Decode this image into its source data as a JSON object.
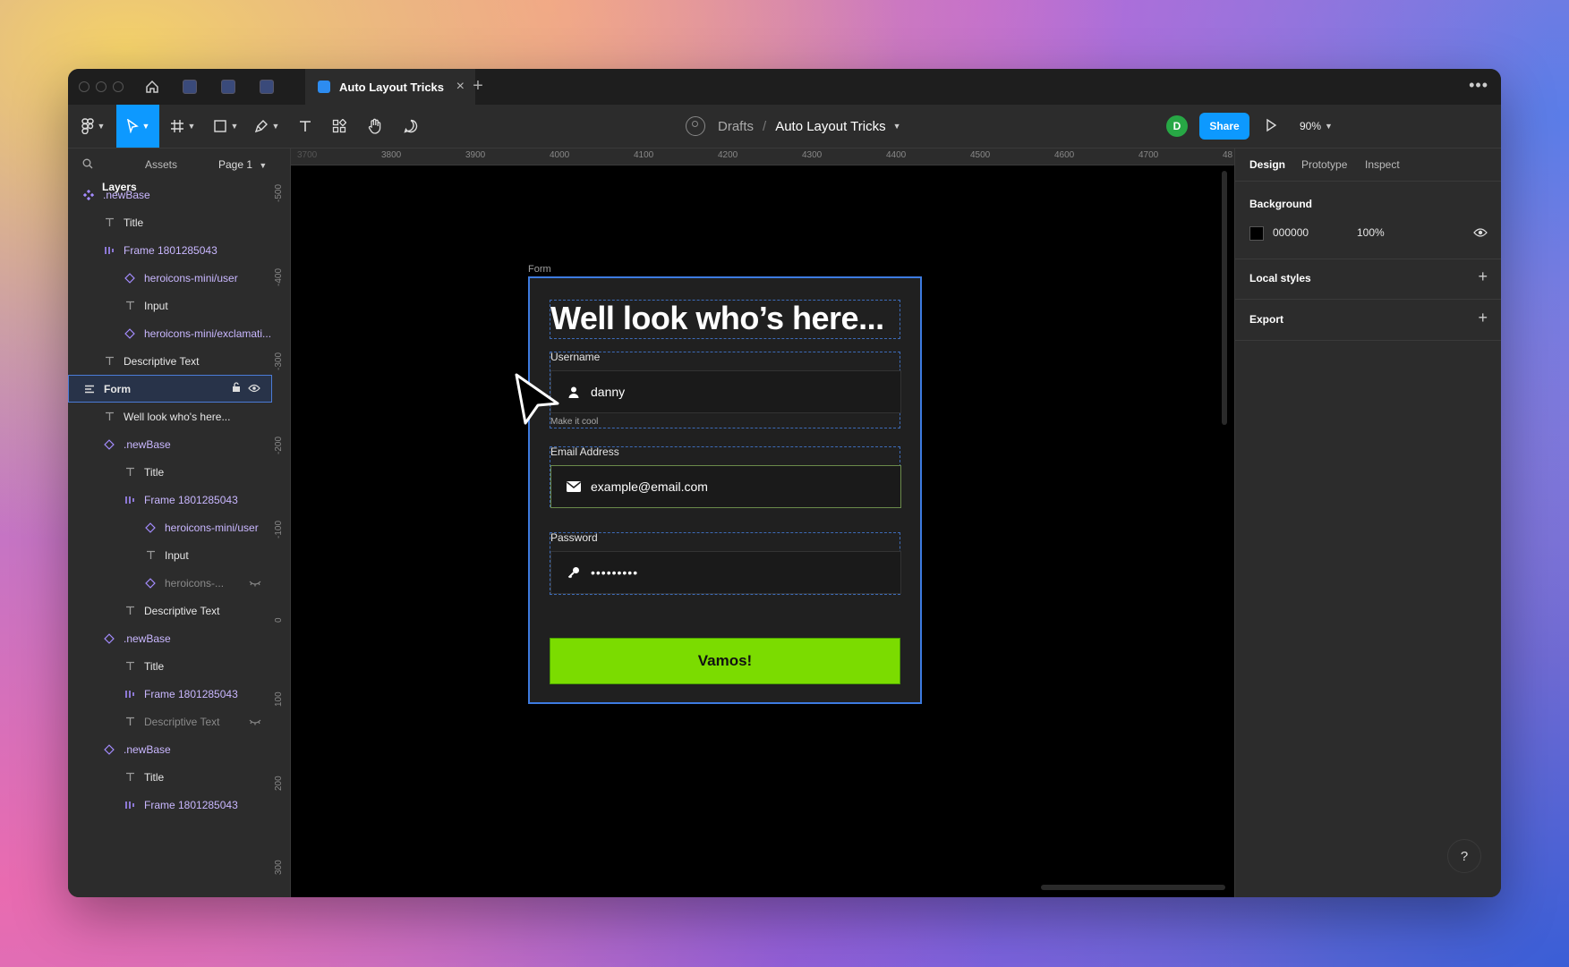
{
  "tabbar": {
    "active_tab": "Auto Layout Tricks",
    "close": "×",
    "new_tab": "+",
    "more": "•••"
  },
  "toolbar": {
    "breadcrumb_drafts": "Drafts",
    "breadcrumb_sep": "/",
    "breadcrumb_file": "Auto Layout Tricks",
    "user_initial": "D",
    "share_label": "Share",
    "zoom": "90%"
  },
  "left_panel": {
    "tab_layers": "Layers",
    "tab_assets": "Assets",
    "page": "Page 1",
    "layers": [
      {
        "label": ".newBase",
        "icon": "component-icon",
        "indent": 0,
        "style": "purple"
      },
      {
        "label": "Title",
        "icon": "text-icon",
        "indent": 1,
        "style": ""
      },
      {
        "label": "Frame 1801285043",
        "icon": "autolayout-icon",
        "indent": 1,
        "style": "purple"
      },
      {
        "label": "heroicons-mini/user",
        "icon": "instance-icon",
        "indent": 2,
        "style": "purple"
      },
      {
        "label": "Input",
        "icon": "text-icon",
        "indent": 2,
        "style": ""
      },
      {
        "label": "heroicons-mini/exclamati...",
        "icon": "instance-icon",
        "indent": 2,
        "style": "purple"
      },
      {
        "label": "Descriptive Text",
        "icon": "text-icon",
        "indent": 1,
        "style": ""
      },
      {
        "label": "Form",
        "icon": "autolayout-rows-icon",
        "indent": 0,
        "style": "selected"
      },
      {
        "label": "Well look who's here...",
        "icon": "text-icon",
        "indent": 1,
        "style": ""
      },
      {
        "label": ".newBase",
        "icon": "instance-icon",
        "indent": 1,
        "style": "purple"
      },
      {
        "label": "Title",
        "icon": "text-icon",
        "indent": 2,
        "style": ""
      },
      {
        "label": "Frame 1801285043",
        "icon": "autolayout-icon",
        "indent": 2,
        "style": "purple"
      },
      {
        "label": "heroicons-mini/user",
        "icon": "instance-icon",
        "indent": 3,
        "style": "purple"
      },
      {
        "label": "Input",
        "icon": "text-icon",
        "indent": 3,
        "style": ""
      },
      {
        "label": "heroicons-...",
        "icon": "instance-icon",
        "indent": 3,
        "style": "dim-hidden"
      },
      {
        "label": "Descriptive Text",
        "icon": "text-icon",
        "indent": 2,
        "style": ""
      },
      {
        "label": ".newBase",
        "icon": "instance-icon",
        "indent": 1,
        "style": "purple"
      },
      {
        "label": "Title",
        "icon": "text-icon",
        "indent": 2,
        "style": ""
      },
      {
        "label": "Frame 1801285043",
        "icon": "autolayout-icon",
        "indent": 2,
        "style": "purple"
      },
      {
        "label": "Descriptive Text",
        "icon": "text-icon",
        "indent": 2,
        "style": "dim-hidden"
      },
      {
        "label": ".newBase",
        "icon": "instance-icon",
        "indent": 1,
        "style": "purple"
      },
      {
        "label": "Title",
        "icon": "text-icon",
        "indent": 2,
        "style": ""
      },
      {
        "label": "Frame 1801285043",
        "icon": "autolayout-icon",
        "indent": 2,
        "style": "purple"
      }
    ]
  },
  "rulers": {
    "top": [
      "3700",
      "3800",
      "3900",
      "4000",
      "4100",
      "4200",
      "4300",
      "4400",
      "4500",
      "4600",
      "4700",
      "48"
    ],
    "left": [
      "-500",
      "-400",
      "-300",
      "-200",
      "-100",
      "0",
      "100",
      "200",
      "300"
    ]
  },
  "canvas": {
    "frame_label": "Form",
    "title": "Well look who’s here...",
    "username_label": "Username",
    "username_value": "danny",
    "username_help": "Make it cool",
    "email_label": "Email Address",
    "email_value": "example@email.com",
    "password_label": "Password",
    "password_value": "•••••••••",
    "submit_label": "Vamos!",
    "accent_color": "#7bdc00",
    "selection_color": "#3d7be0"
  },
  "right_panel": {
    "tab_design": "Design",
    "tab_prototype": "Prototype",
    "tab_inspect": "Inspect",
    "background_heading": "Background",
    "background_hex": "000000",
    "background_opacity": "100%",
    "local_styles_heading": "Local styles",
    "export_heading": "Export",
    "plus": "+"
  },
  "help_label": "?"
}
